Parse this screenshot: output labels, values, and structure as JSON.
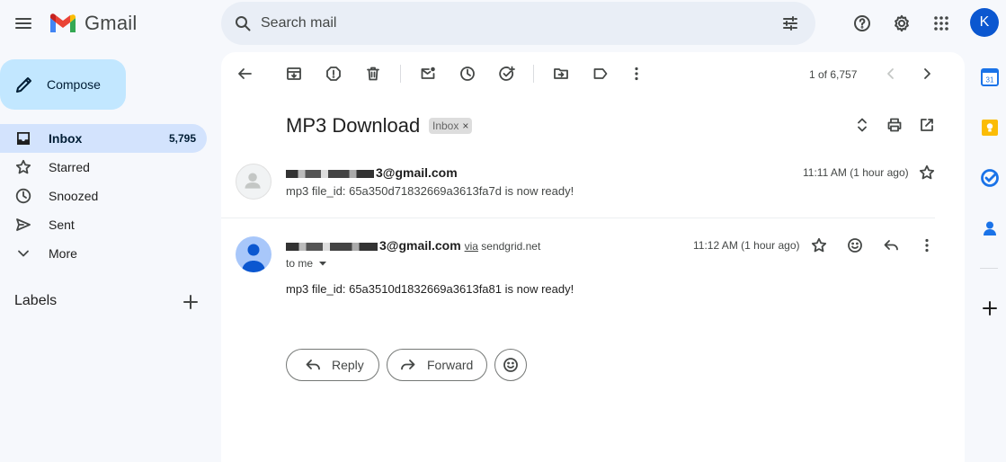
{
  "header": {
    "logo_text": "Gmail",
    "search_placeholder": "Search mail",
    "avatar_letter": "K"
  },
  "sidebar": {
    "compose_label": "Compose",
    "items": [
      {
        "label": "Inbox",
        "count": "5,795",
        "icon": "inbox-icon",
        "active": true
      },
      {
        "label": "Starred",
        "icon": "star-icon"
      },
      {
        "label": "Snoozed",
        "icon": "clock-icon"
      },
      {
        "label": "Sent",
        "icon": "send-icon"
      },
      {
        "label": "More",
        "icon": "chevron-down-icon"
      }
    ],
    "labels_title": "Labels"
  },
  "toolbar": {
    "pager": "1 of 6,757"
  },
  "thread": {
    "subject": "MP3 Download",
    "label_chip": "Inbox",
    "messages": [
      {
        "sender_suffix": "3@gmail.com",
        "snippet": "mp3 file_id: 65a350d71832669a3613fa7d is now ready!",
        "time": "11:11 AM (1 hour ago)"
      },
      {
        "sender_suffix": "3@gmail.com",
        "via_label": "via",
        "via_domain": "sendgrid.net",
        "to_label": "to me",
        "body": "mp3 file_id: 65a3510d1832669a3613fa81 is now ready!",
        "time": "11:12 AM (1 hour ago)"
      }
    ],
    "reply_label": "Reply",
    "forward_label": "Forward"
  },
  "right_rail": {
    "calendar_day": "31"
  },
  "colors": {
    "accent": "#0b57d0",
    "compose_bg": "#c2e7ff",
    "active_nav_bg": "#d3e3fd",
    "keep_yellow": "#fbbc04",
    "tasks_blue": "#1a73e8"
  }
}
